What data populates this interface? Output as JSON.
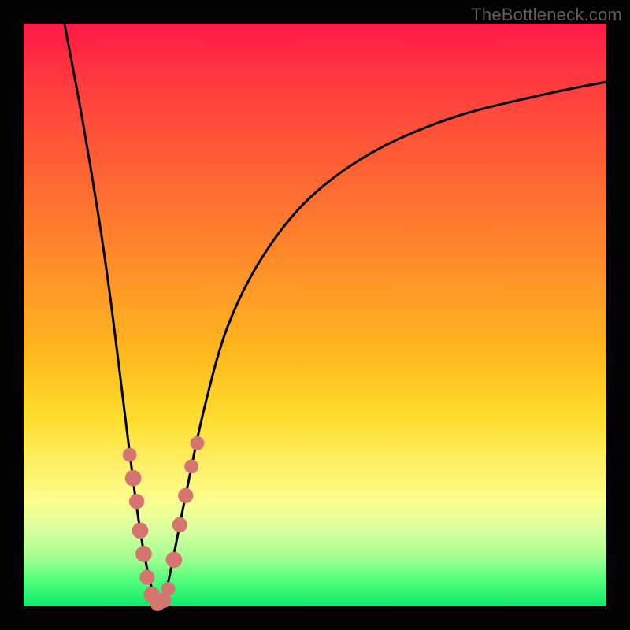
{
  "watermark": "TheBottleneck.com",
  "chart_data": {
    "type": "line",
    "title": "",
    "xlabel": "",
    "ylabel": "",
    "xlim": [
      0,
      100
    ],
    "ylim": [
      0,
      100
    ],
    "grid": false,
    "legend": false,
    "series": [
      {
        "name": "curve-left",
        "x": [
          7,
          10,
          13,
          15,
          17,
          19,
          20.5,
          22,
          23
        ],
        "y": [
          100,
          84,
          66,
          52,
          36,
          20,
          10,
          3,
          0
        ]
      },
      {
        "name": "curve-right",
        "x": [
          23,
          24.5,
          26,
          28,
          31,
          35,
          41,
          49,
          60,
          74,
          90,
          100
        ],
        "y": [
          0,
          3,
          10,
          20,
          34,
          48,
          60,
          70,
          78,
          84,
          88,
          90
        ]
      }
    ],
    "markers": [
      {
        "x": 18.2,
        "y": 26,
        "r": 1.2
      },
      {
        "x": 18.8,
        "y": 22,
        "r": 1.4
      },
      {
        "x": 19.4,
        "y": 18,
        "r": 1.3
      },
      {
        "x": 20.0,
        "y": 13,
        "r": 1.4
      },
      {
        "x": 20.6,
        "y": 9,
        "r": 1.4
      },
      {
        "x": 21.2,
        "y": 5,
        "r": 1.3
      },
      {
        "x": 22.0,
        "y": 2,
        "r": 1.4
      },
      {
        "x": 23.0,
        "y": 0.5,
        "r": 1.3
      },
      {
        "x": 24.0,
        "y": 1,
        "r": 1.3
      },
      {
        "x": 24.8,
        "y": 3,
        "r": 1.2
      },
      {
        "x": 25.8,
        "y": 8,
        "r": 1.4
      },
      {
        "x": 26.8,
        "y": 14,
        "r": 1.3
      },
      {
        "x": 27.8,
        "y": 19,
        "r": 1.3
      },
      {
        "x": 28.8,
        "y": 24,
        "r": 1.2
      },
      {
        "x": 29.8,
        "y": 28,
        "r": 1.2
      }
    ],
    "colors": {
      "curve": "#000000",
      "marker": "#d6746f",
      "gradient_top": "#ff1a46",
      "gradient_mid": "#ffde30",
      "gradient_bottom": "#10e86a"
    }
  }
}
